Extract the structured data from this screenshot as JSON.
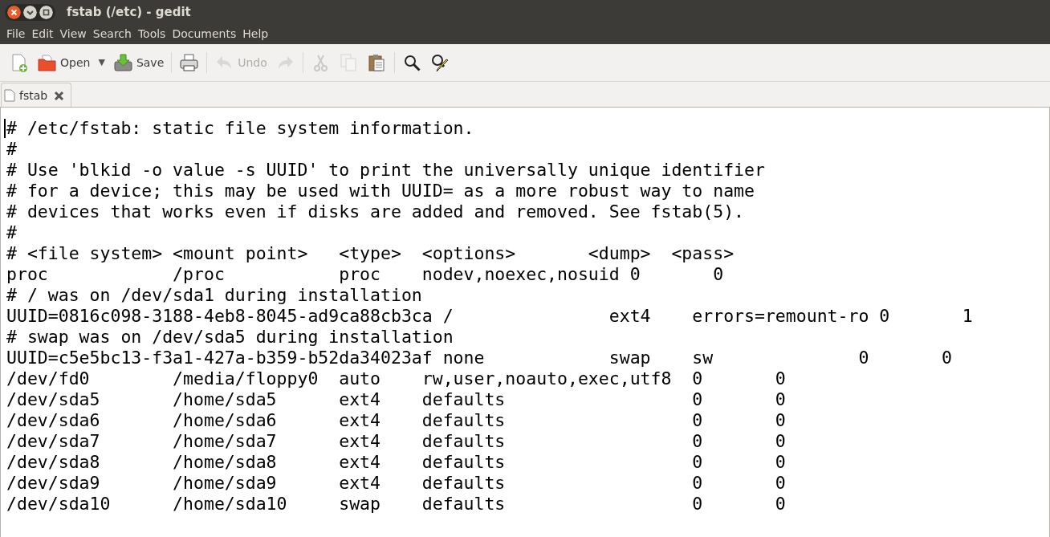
{
  "window": {
    "title": "fstab (/etc) - gedit"
  },
  "menu": [
    "File",
    "Edit",
    "View",
    "Search",
    "Tools",
    "Documents",
    "Help"
  ],
  "toolbar": [
    {
      "kind": "button",
      "disabled": false
    },
    {
      "kind": "button",
      "label": "Open",
      "disabled": false
    },
    {
      "kind": "dropdown",
      "label": "▼"
    },
    {
      "kind": "button",
      "label": "Save",
      "disabled": false
    },
    {
      "kind": "separator"
    },
    {
      "kind": "button",
      "disabled": false
    },
    {
      "kind": "separator"
    },
    {
      "kind": "button",
      "label": "Undo",
      "disabled": true
    },
    {
      "kind": "button",
      "disabled": true
    },
    {
      "kind": "separator"
    },
    {
      "kind": "button",
      "disabled": true
    },
    {
      "kind": "button",
      "disabled": true
    },
    {
      "kind": "button",
      "disabled": false
    },
    {
      "kind": "separator"
    },
    {
      "kind": "button",
      "disabled": false
    },
    {
      "kind": "button",
      "disabled": false
    }
  ],
  "tabs": [
    {
      "label": "fstab",
      "selected": true
    }
  ],
  "editor": {
    "lines": [
      "# /etc/fstab: static file system information.",
      "#",
      "# Use 'blkid -o value -s UUID' to print the universally unique identifier",
      "# for a device; this may be used with UUID= as a more robust way to name",
      "# devices that works even if disks are added and removed. See fstab(5).",
      "#",
      "# <file system> <mount point>   <type>  <options>       <dump>  <pass>",
      "proc            /proc           proc    nodev,noexec,nosuid 0       0",
      "# / was on /dev/sda1 during installation",
      "UUID=0816c098-3188-4eb8-8045-ad9ca88cb3ca /               ext4    errors=remount-ro 0       1",
      "# swap was on /dev/sda5 during installation",
      "UUID=c5e5bc13-f3a1-427a-b359-b52da34023af none            swap    sw              0       0",
      "/dev/fd0        /media/floppy0  auto    rw,user,noauto,exec,utf8  0       0",
      "/dev/sda5       /home/sda5      ext4    defaults                  0       0",
      "/dev/sda6       /home/sda6      ext4    defaults                  0       0",
      "/dev/sda7       /home/sda7      ext4    defaults                  0       0",
      "/dev/sda8       /home/sda8      ext4    defaults                  0       0",
      "/dev/sda9       /home/sda9      ext4    defaults                  0       0",
      "/dev/sda10      /home/sda10     swap    defaults                  0       0"
    ]
  }
}
